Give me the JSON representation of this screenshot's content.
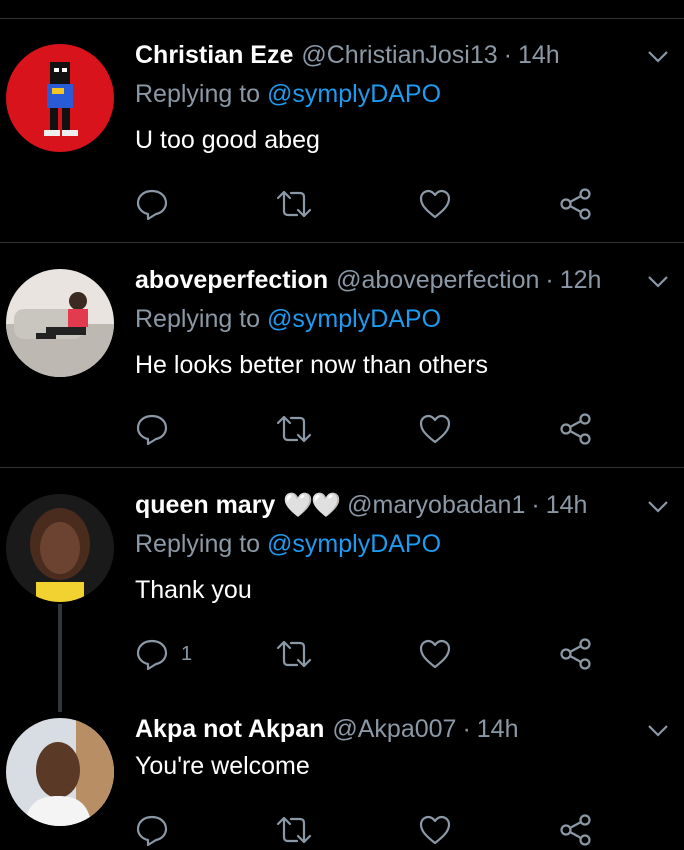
{
  "tweets": [
    {
      "name": "Christian Eze",
      "handle": "@ChristianJosi13",
      "time": "14h",
      "reply_prefix": "Replying to",
      "reply_to": "@symplyDAPO",
      "text": "U too good abeg",
      "reply_count": ""
    },
    {
      "name": "aboveperfection",
      "handle": "@aboveperfection",
      "time": "12h",
      "reply_prefix": "Replying to",
      "reply_to": "@symplyDAPO",
      "text": "He looks better now than others",
      "reply_count": ""
    },
    {
      "name": "queen mary",
      "hearts": "🤍🤍",
      "handle": "@maryobadan1",
      "time": "14h",
      "reply_prefix": "Replying to",
      "reply_to": "@symplyDAPO",
      "text": "Thank you",
      "reply_count": "1"
    },
    {
      "name": "Akpa not Akpan",
      "handle": "@Akpa007",
      "time": "14h",
      "text": "You're welcome",
      "reply_count": ""
    }
  ],
  "colors": {
    "background": "#000000",
    "secondary_text": "#8b98a5",
    "link": "#1d9bf0",
    "divider": "#2f3336"
  },
  "icons": [
    "reply-icon",
    "retweet-icon",
    "like-icon",
    "share-icon",
    "chevron-down-icon"
  ]
}
